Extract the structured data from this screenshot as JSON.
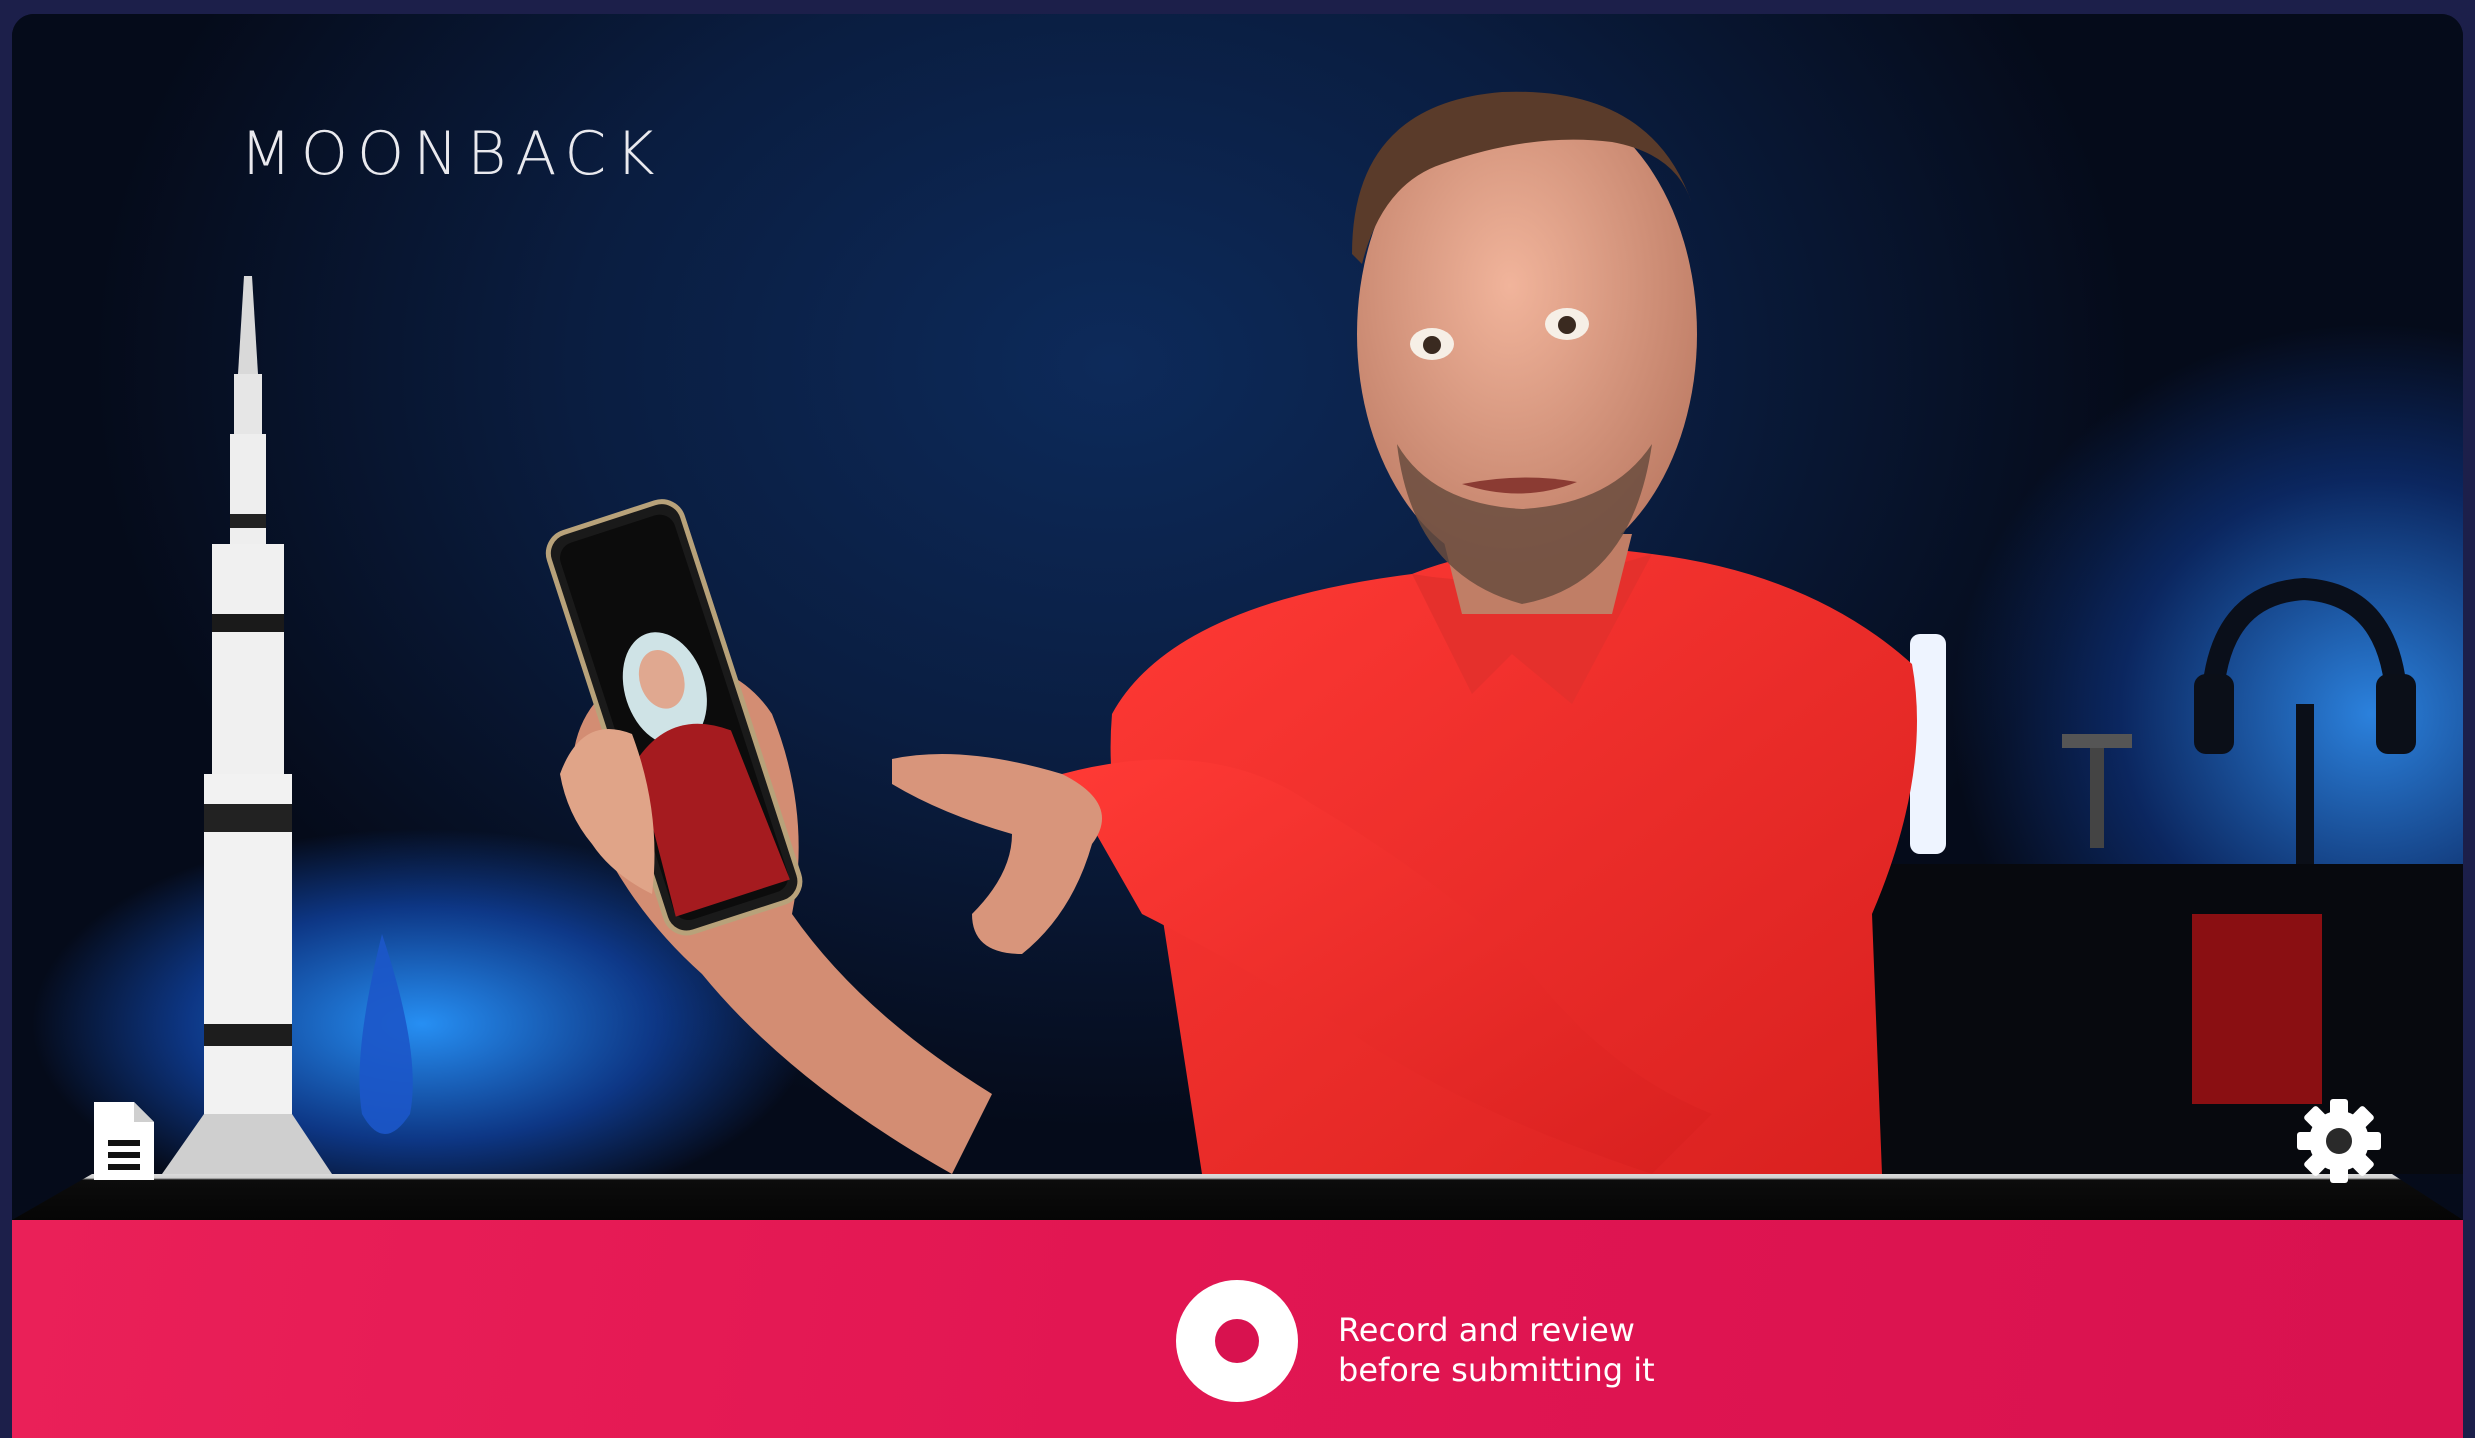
{
  "brand": {
    "logo_text": "MOONBACK"
  },
  "controls": {
    "record_label_line1": "Record and review",
    "record_label_line2": "before submitting it",
    "document_icon": "document-icon",
    "settings_icon": "gear-icon",
    "record_icon": "record-icon"
  },
  "colors": {
    "accent": "#e21652",
    "frame": "#1c1f4a"
  }
}
